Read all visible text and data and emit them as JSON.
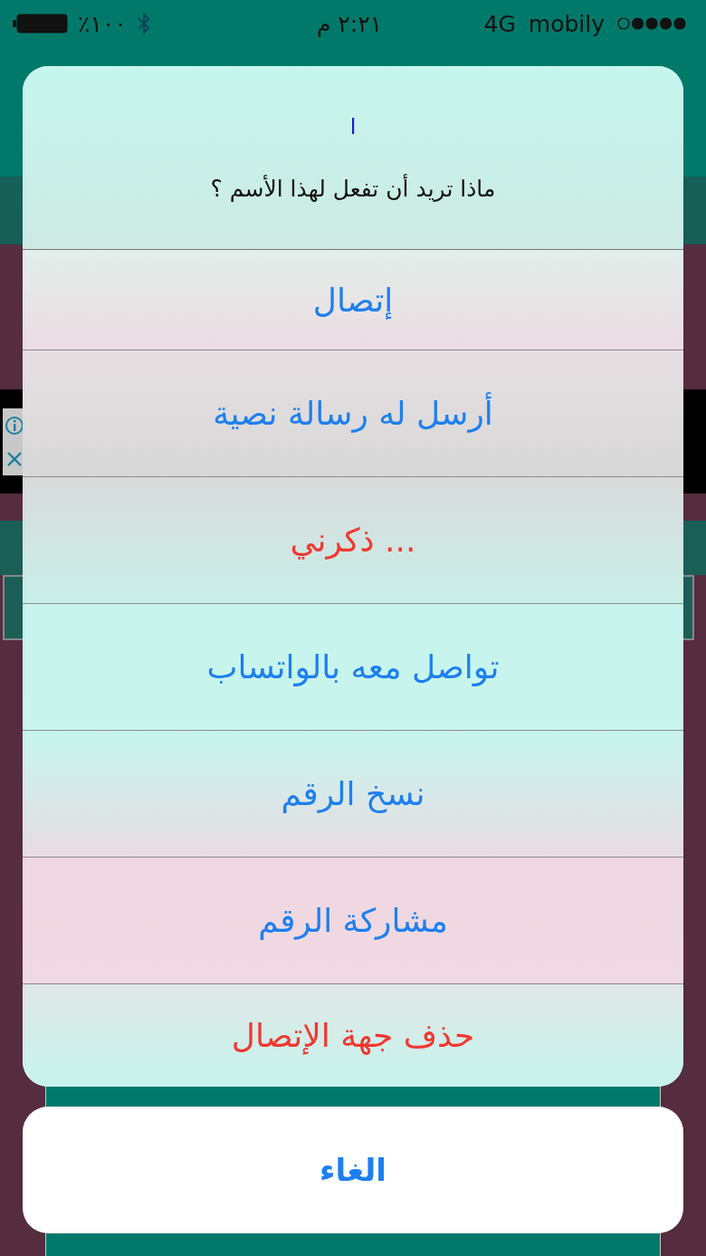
{
  "status_bar": {
    "carrier": "mobily",
    "network": "4G",
    "time": "٢:٢١ م",
    "battery": "٪١٠٠"
  },
  "action_sheet": {
    "title": "ا",
    "message": "ماذا تريد أن تفعل لهذا الأسم ؟",
    "actions": [
      {
        "label": "إتصال",
        "kind": "default"
      },
      {
        "label": "أرسل له رسالة نصية",
        "kind": "default"
      },
      {
        "label": "ذكرني ...",
        "kind": "destructive"
      },
      {
        "label": "تواصل معه بالواتساب",
        "kind": "default"
      },
      {
        "label": "نسخ الرقم",
        "kind": "default"
      },
      {
        "label": "مشاركة الرقم",
        "kind": "default"
      },
      {
        "label": "حذف جهة الإتصال",
        "kind": "destructive"
      }
    ],
    "cancel": "الغاء"
  }
}
